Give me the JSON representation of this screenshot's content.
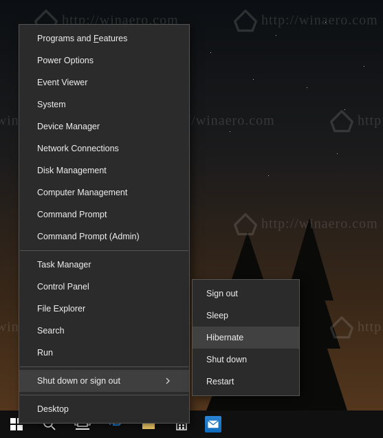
{
  "watermark_text": "http://winaero.com",
  "menu": {
    "group1": [
      "Programs and Features",
      "Power Options",
      "Event Viewer",
      "System",
      "Device Manager",
      "Network Connections",
      "Disk Management",
      "Computer Management",
      "Command Prompt",
      "Command Prompt (Admin)"
    ],
    "group2": [
      "Task Manager",
      "Control Panel",
      "File Explorer",
      "Search",
      "Run"
    ],
    "group3": [
      "Shut down or sign out"
    ],
    "group4": [
      "Desktop"
    ],
    "highlighted": "Shut down or sign out"
  },
  "submenu": {
    "items": [
      "Sign out",
      "Sleep",
      "Hibernate",
      "Shut down",
      "Restart"
    ],
    "highlighted": "Hibernate"
  },
  "taskbar": {
    "apps": [
      {
        "name": "mail-app",
        "color": "#0f6bbd"
      }
    ]
  },
  "icons": {
    "start": "start-icon",
    "search": "search-icon",
    "taskview": "task-view-icon",
    "edge": "edge-icon",
    "explorer": "file-explorer-icon",
    "store": "store-icon"
  }
}
